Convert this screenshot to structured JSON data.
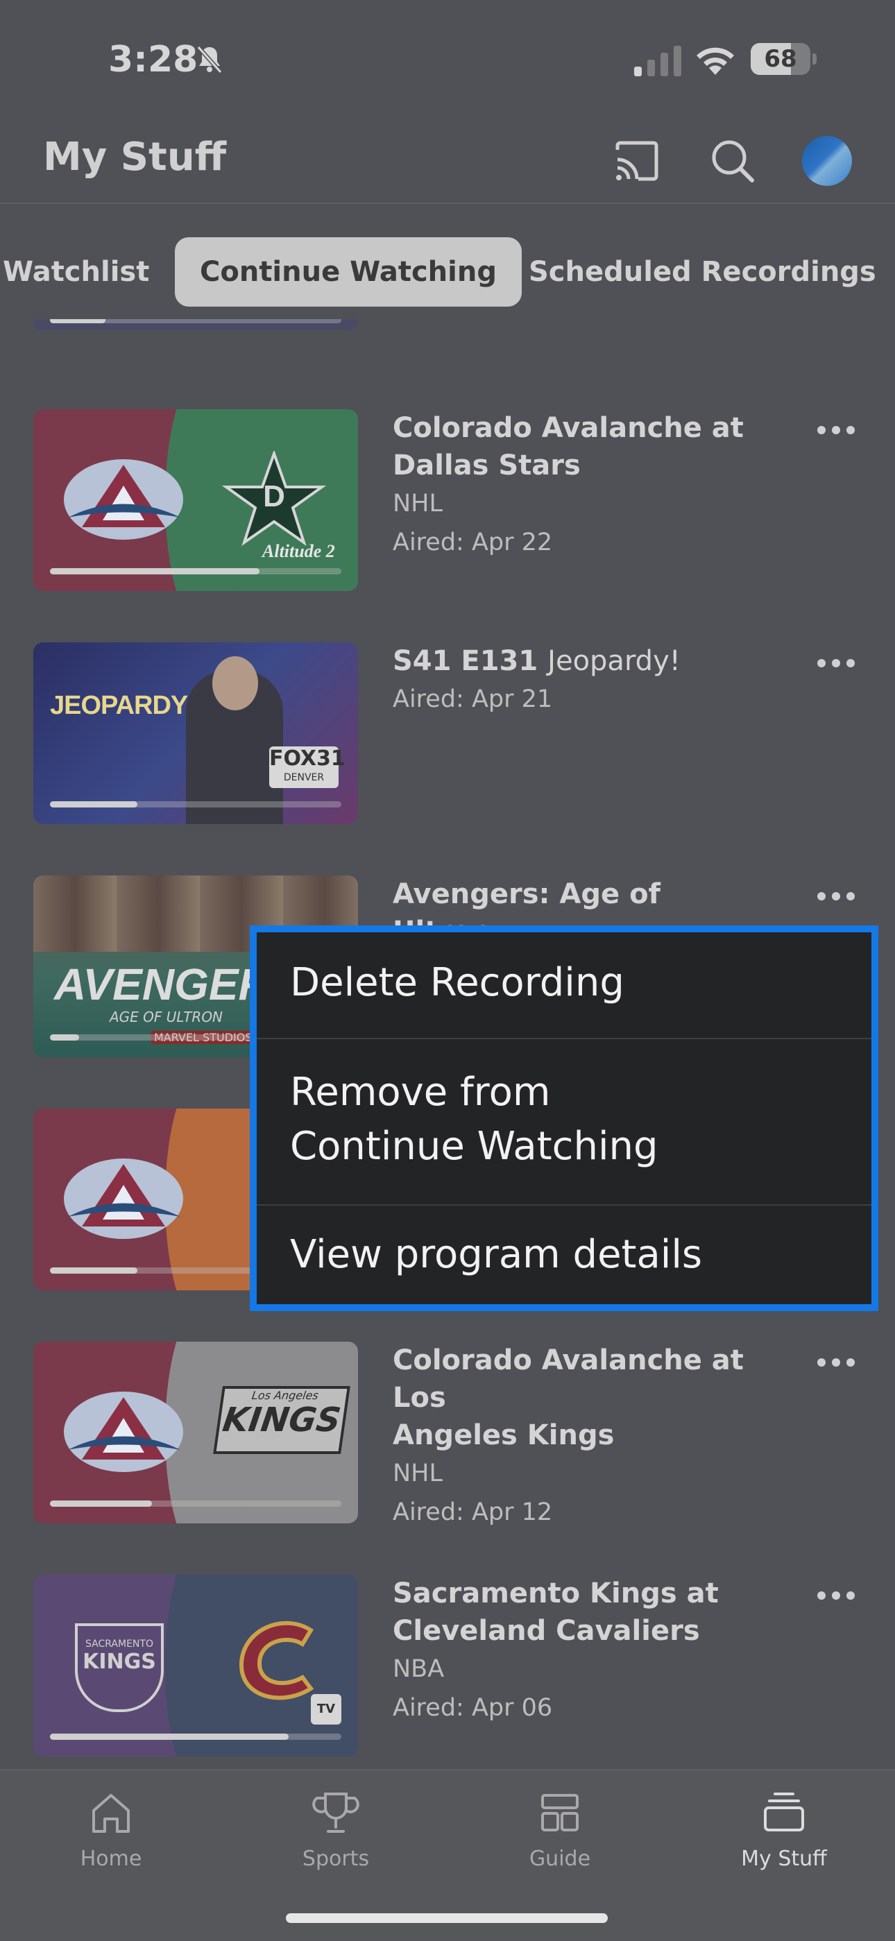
{
  "status_bar": {
    "time": "3:28",
    "battery": "68"
  },
  "header": {
    "title": "My Stuff"
  },
  "tabs": [
    {
      "label": "Watchlist",
      "active": false
    },
    {
      "label": "Continue Watching",
      "active": true
    },
    {
      "label": "Scheduled Recordings",
      "active": false
    }
  ],
  "rows": [
    {
      "title": "Colorado Avalanche at Dallas Stars",
      "title_line1": "Colorado Avalanche at",
      "title_line2": "Dallas Stars",
      "league": "NHL",
      "aired": "Aired: Apr 22",
      "progress": 0.72,
      "left_color": "#7a3a4b",
      "right_color": "#3f7a58",
      "right_logo_text": "Altitude 2"
    },
    {
      "episode": "S41 E131",
      "show": "Jeopardy!",
      "aired": "Aired: Apr 21",
      "progress": 0.3,
      "thumb_text": "JEOPARDY!",
      "badge": "FOX31",
      "badge_sub": "DENVER"
    },
    {
      "title": "Avengers: Age of Ultron",
      "progress": 0.1,
      "thumb_text": "AVENGERS",
      "thumb_sub": "AGE OF ULTRON",
      "thumb_studio": "MARVEL STUDIOS"
    },
    {
      "progress": 0.3,
      "left_color": "#7a3a4b",
      "right_color": "#b76a3d"
    },
    {
      "title": "Colorado Avalanche at Los Angeles Kings",
      "title_line1": "Colorado Avalanche at Los",
      "title_line2": "Angeles Kings",
      "league": "NHL",
      "aired": "Aired: Apr 12",
      "progress": 0.35,
      "left_color": "#7a3a4b",
      "right_color": "#8c8c8e",
      "right_logo_text": "KINGS",
      "right_logo_sub": "Los Angeles"
    },
    {
      "title": "Sacramento Kings at Cleveland Cavaliers",
      "title_line1": "Sacramento Kings at",
      "title_line2": "Cleveland Cavaliers",
      "league": "NBA",
      "aired": "Aired: Apr 06",
      "progress": 0.82,
      "left_color": "#5a4a73",
      "right_color": "#424d66",
      "left_logo_text": "KINGS",
      "left_logo_sub": "SACRAMENTO"
    }
  ],
  "context_menu": {
    "items": [
      {
        "line1": "Delete Recording"
      },
      {
        "line1": "Remove from",
        "line2": "Continue Watching"
      },
      {
        "line1": "View program details"
      }
    ]
  },
  "bottom_nav": [
    {
      "label": "Home",
      "icon": "home-icon",
      "active": false
    },
    {
      "label": "Sports",
      "icon": "trophy-icon",
      "active": false
    },
    {
      "label": "Guide",
      "icon": "guide-icon",
      "active": false
    },
    {
      "label": "My Stuff",
      "icon": "stack-icon",
      "active": true
    }
  ]
}
